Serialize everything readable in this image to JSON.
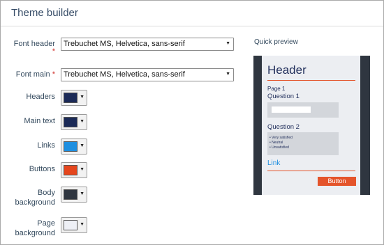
{
  "title": "Theme builder",
  "fields": {
    "font_header": {
      "label": "Font header",
      "required": "*",
      "value": "Trebuchet MS, Helvetica, sans-serif"
    },
    "font_main": {
      "label": "Font main",
      "required": "*",
      "value": "Trebuchet MS, Helvetica, sans-serif"
    },
    "colors": [
      {
        "label": "Headers",
        "color": "#1b2a57"
      },
      {
        "label": "Main text",
        "color": "#1b2a57"
      },
      {
        "label": "Links",
        "color": "#1e8fe0"
      },
      {
        "label": "Buttons",
        "color": "#e5461d"
      },
      {
        "label": "Body background",
        "color": "#2f3640"
      },
      {
        "label": "Page background",
        "color": "#eef0f6"
      }
    ]
  },
  "preview": {
    "label": "Quick preview",
    "header": "Header",
    "page": "Page 1",
    "question1": "Question 1",
    "question2": "Question 2",
    "options": [
      "Very satisfied",
      "Neutral",
      "Unsatisfied"
    ],
    "link": "Link",
    "button": "Button"
  }
}
